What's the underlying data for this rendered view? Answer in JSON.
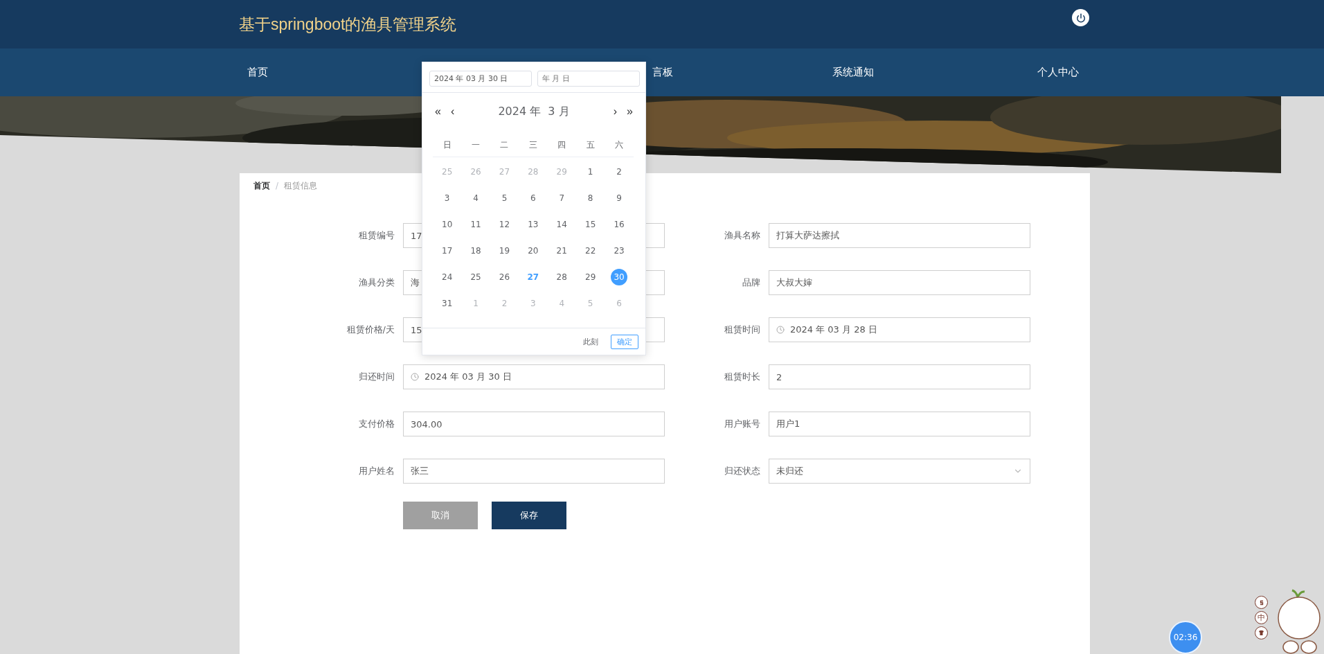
{
  "header": {
    "title": "基于springboot的渔具管理系统"
  },
  "nav": [
    {
      "label": "首页"
    },
    {
      "label": "言板"
    },
    {
      "label": "系统通知"
    },
    {
      "label": "个人中心"
    }
  ],
  "breadcrumb": {
    "items": [
      {
        "label": "首页",
        "current": false
      },
      {
        "label": "租赁信息",
        "current": true
      }
    ],
    "separator": "/"
  },
  "form": {
    "fields": [
      {
        "label": "租赁编号",
        "value": "17",
        "kind": "text"
      },
      {
        "label": "渔具名称",
        "value": "打算大萨达擦拭",
        "kind": "text"
      },
      {
        "label": "渔具分类",
        "value": "海",
        "kind": "text"
      },
      {
        "label": "品牌",
        "value": "大叔大婶",
        "kind": "text"
      },
      {
        "label": "租赁价格/天",
        "value": "15",
        "kind": "text"
      },
      {
        "label": "租赁时间",
        "value": "2024 年 03 月 28 日",
        "kind": "date"
      },
      {
        "label": "归还时间",
        "value": "2024 年 03 月 30 日",
        "kind": "date"
      },
      {
        "label": "租赁时长",
        "value": "2",
        "kind": "text"
      },
      {
        "label": "支付价格",
        "value": "304.00",
        "kind": "text"
      },
      {
        "label": "用户账号",
        "value": "用户1",
        "kind": "text"
      },
      {
        "label": "用户姓名",
        "value": "张三",
        "kind": "text"
      },
      {
        "label": "归还状态",
        "value": "未归还",
        "kind": "select"
      }
    ],
    "buttons": [
      {
        "label": "取消",
        "kind": "cancel"
      },
      {
        "label": "保存",
        "kind": "save"
      }
    ]
  },
  "date_picker": {
    "start_value": "2024 年 03 月 30 日",
    "end_placeholder": "年 月 日",
    "month_title": "2024 年  3 月",
    "prev_year": "«",
    "prev_month": "‹",
    "next_month": "›",
    "next_year": "»",
    "weekdays": [
      "日",
      "一",
      "二",
      "三",
      "四",
      "五",
      "六"
    ],
    "days": [
      {
        "label": "25",
        "muted": true,
        "today": false,
        "selected": false
      },
      {
        "label": "26",
        "muted": true,
        "today": false,
        "selected": false
      },
      {
        "label": "27",
        "muted": true,
        "today": false,
        "selected": false
      },
      {
        "label": "28",
        "muted": true,
        "today": false,
        "selected": false
      },
      {
        "label": "29",
        "muted": true,
        "today": false,
        "selected": false
      },
      {
        "label": "1",
        "muted": false,
        "today": false,
        "selected": false
      },
      {
        "label": "2",
        "muted": false,
        "today": false,
        "selected": false
      },
      {
        "label": "3",
        "muted": false,
        "today": false,
        "selected": false
      },
      {
        "label": "4",
        "muted": false,
        "today": false,
        "selected": false
      },
      {
        "label": "5",
        "muted": false,
        "today": false,
        "selected": false
      },
      {
        "label": "6",
        "muted": false,
        "today": false,
        "selected": false
      },
      {
        "label": "7",
        "muted": false,
        "today": false,
        "selected": false
      },
      {
        "label": "8",
        "muted": false,
        "today": false,
        "selected": false
      },
      {
        "label": "9",
        "muted": false,
        "today": false,
        "selected": false
      },
      {
        "label": "10",
        "muted": false,
        "today": false,
        "selected": false
      },
      {
        "label": "11",
        "muted": false,
        "today": false,
        "selected": false
      },
      {
        "label": "12",
        "muted": false,
        "today": false,
        "selected": false
      },
      {
        "label": "13",
        "muted": false,
        "today": false,
        "selected": false
      },
      {
        "label": "14",
        "muted": false,
        "today": false,
        "selected": false
      },
      {
        "label": "15",
        "muted": false,
        "today": false,
        "selected": false
      },
      {
        "label": "16",
        "muted": false,
        "today": false,
        "selected": false
      },
      {
        "label": "17",
        "muted": false,
        "today": false,
        "selected": false
      },
      {
        "label": "18",
        "muted": false,
        "today": false,
        "selected": false
      },
      {
        "label": "19",
        "muted": false,
        "today": false,
        "selected": false
      },
      {
        "label": "20",
        "muted": false,
        "today": false,
        "selected": false
      },
      {
        "label": "21",
        "muted": false,
        "today": false,
        "selected": false
      },
      {
        "label": "22",
        "muted": false,
        "today": false,
        "selected": false
      },
      {
        "label": "23",
        "muted": false,
        "today": false,
        "selected": false
      },
      {
        "label": "24",
        "muted": false,
        "today": false,
        "selected": false
      },
      {
        "label": "25",
        "muted": false,
        "today": false,
        "selected": false
      },
      {
        "label": "26",
        "muted": false,
        "today": false,
        "selected": false
      },
      {
        "label": "27",
        "muted": false,
        "today": true,
        "selected": false
      },
      {
        "label": "28",
        "muted": false,
        "today": false,
        "selected": false
      },
      {
        "label": "29",
        "muted": false,
        "today": false,
        "selected": false
      },
      {
        "label": "30",
        "muted": false,
        "today": false,
        "selected": true
      },
      {
        "label": "31",
        "muted": false,
        "today": false,
        "selected": false
      },
      {
        "label": "1",
        "muted": true,
        "today": false,
        "selected": false
      },
      {
        "label": "2",
        "muted": true,
        "today": false,
        "selected": false
      },
      {
        "label": "3",
        "muted": true,
        "today": false,
        "selected": false
      },
      {
        "label": "4",
        "muted": true,
        "today": false,
        "selected": false
      },
      {
        "label": "5",
        "muted": true,
        "today": false,
        "selected": false
      },
      {
        "label": "6",
        "muted": true,
        "today": false,
        "selected": false
      }
    ],
    "now_button": "此刻",
    "confirm_button": "确定"
  },
  "recorder": {
    "timer": "02:36"
  },
  "ime": {
    "mode": "中"
  }
}
